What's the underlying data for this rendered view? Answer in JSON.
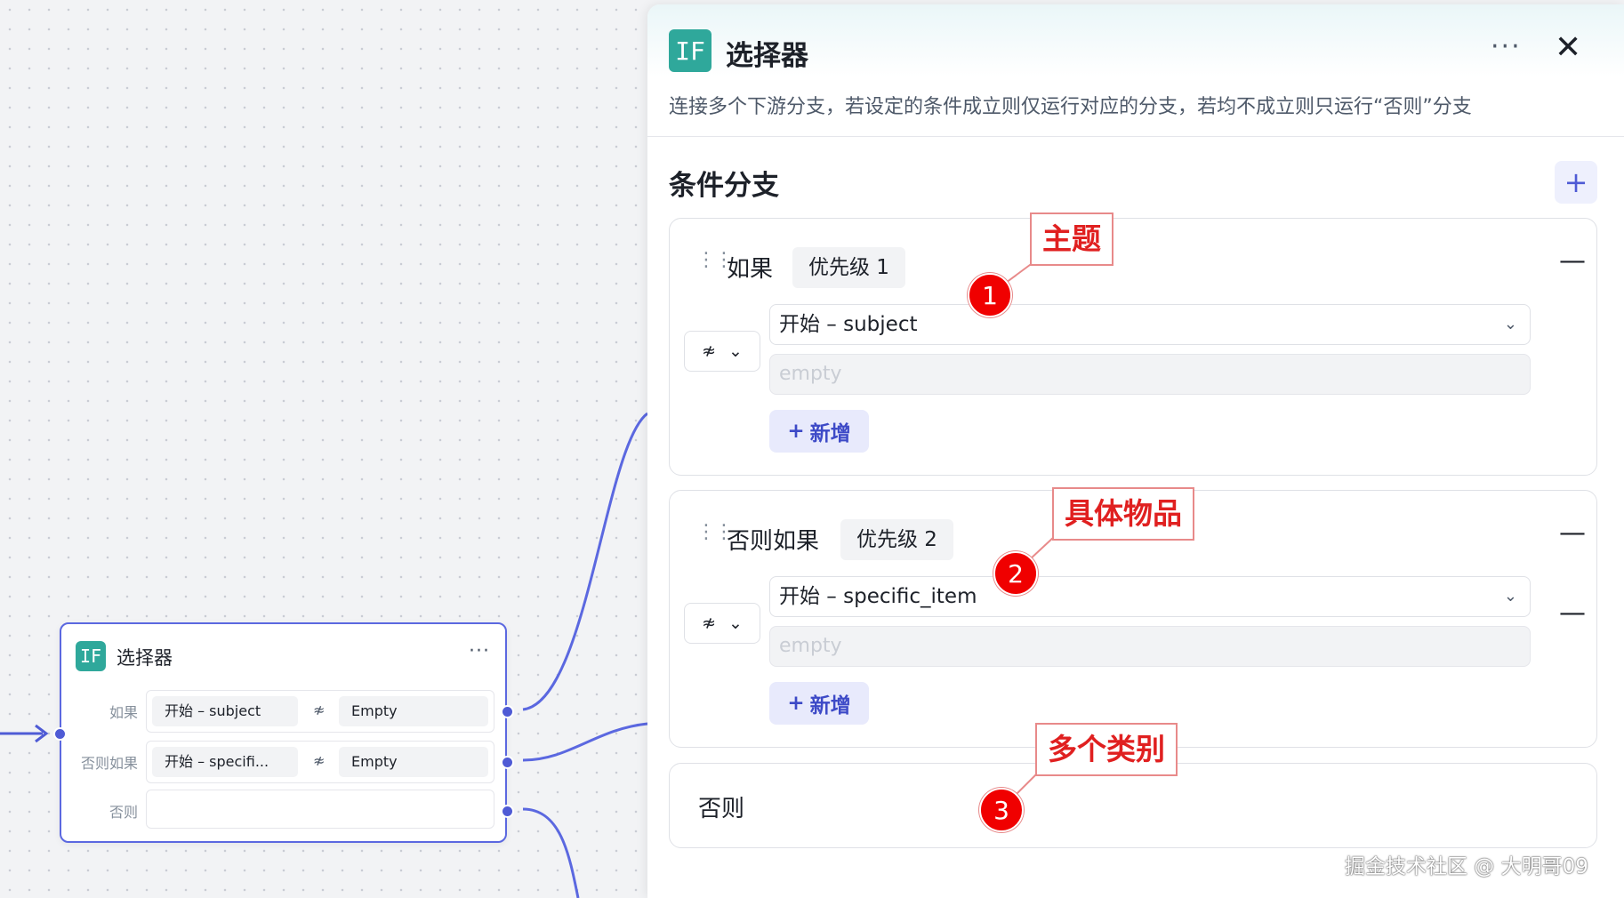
{
  "node": {
    "badge": "IF",
    "title": "选择器",
    "more": "···",
    "rows": [
      {
        "label": "如果",
        "var": "开始  –  subject",
        "op": "≉",
        "value": "Empty"
      },
      {
        "label": "否则如果",
        "var": "开始  –  specifi...",
        "op": "≉",
        "value": "Empty"
      },
      {
        "label": "否则",
        "var": "",
        "op": "",
        "value": ""
      }
    ]
  },
  "panel": {
    "badge": "IF",
    "title": "选择器",
    "more": "···",
    "close": "✕",
    "description": "连接多个下游分支，若设定的条件成立则仅运行对应的分支，若均不成立则只运行“否则”分支",
    "section_title": "条件分支",
    "add_branch": "+",
    "branches": [
      {
        "label": "如果",
        "priority": "优先级 1",
        "operator": "≉",
        "variable": "开始  –  subject",
        "placeholder": "empty",
        "add_label": "新增",
        "add_icon": "+"
      },
      {
        "label": "否则如果",
        "priority": "优先级 2",
        "operator": "≉",
        "variable": "开始  –  specific_item",
        "placeholder": "empty",
        "add_label": "新增",
        "add_icon": "+"
      }
    ],
    "else_label": "否则",
    "minus": "—"
  },
  "annotations": [
    {
      "num": "1",
      "text": "主题"
    },
    {
      "num": "2",
      "text": "具体物品"
    },
    {
      "num": "3",
      "text": "多个类别"
    }
  ],
  "watermark": "掘金技术社区 @ 大明哥09",
  "colors": {
    "accent": "#4f5bd5",
    "if_badge": "#2fa89b",
    "annotation": "#e02020"
  }
}
